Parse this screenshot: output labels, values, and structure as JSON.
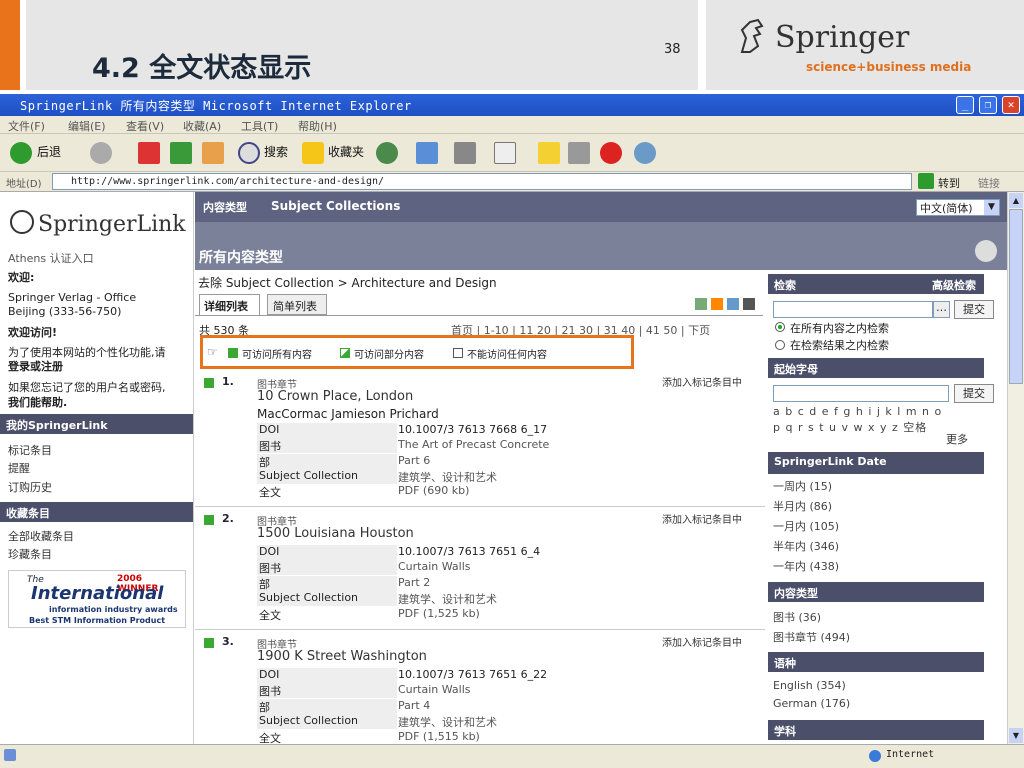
{
  "slide": {
    "title": "4.2 全文状态显示",
    "page": "38",
    "brand": "Springer",
    "tagline": "science+business media"
  },
  "window": {
    "title": "SpringerLink   所有内容类型   Microsoft Internet Explorer",
    "menu": [
      "文件(F)",
      "编辑(E)",
      "查看(V)",
      "收藏(A)",
      "工具(T)",
      "帮助(H)"
    ]
  },
  "toolbar": {
    "back": "后退",
    "search": "搜索",
    "favorites": "收藏夹"
  },
  "address": {
    "label": "地址(D)",
    "url": "http://www.springerlink.com/architecture-and-design/",
    "go": "转到",
    "links": "链接"
  },
  "left": {
    "logo": "SpringerLink",
    "athens": "Athens 认证入口",
    "welcome": "欢迎:",
    "org1": "Springer Verlag - Office",
    "org2": "Beijing (333-56-750)",
    "visit": "欢迎访问!",
    "p1": "为了使用本网站的个性化功能,请",
    "p1b": "登录或注册",
    "p2": "如果您忘记了您的用户名或密码,",
    "p2b": "我们能帮助.",
    "mylink": "我的SpringerLink",
    "my_items": [
      "标记条目",
      "提醒",
      "订购历史"
    ],
    "fav_head": "收藏条目",
    "fav_items": [
      "全部收藏条目",
      "珍藏条目"
    ],
    "award1": "The",
    "award2": "2006 WINNER",
    "award3": "International",
    "award4": "information industry awards",
    "award5": "Best STM Information Product"
  },
  "header": {
    "tab1": "内容类型",
    "tab2": "Subject Collections",
    "lang": "中文(简体)",
    "heading": "所有内容类型"
  },
  "center": {
    "crumb": "去除 Subject Collection > Architecture and Design",
    "view_detail": "详细列表",
    "view_brief": "简单列表",
    "total": "共 530 条",
    "pager": "首页 | 1-10 | 11 20 | 21 30 | 31 40 | 41 50 | 下页",
    "legend": [
      "可访问所有内容",
      "可访问部分内容",
      "不能访问任何内容"
    ]
  },
  "items": [
    {
      "num": "1.",
      "type": "图书章节",
      "title": "10 Crown Place, London",
      "author": "MacCormac Jamieson Prichard",
      "add": "添加入标记条目中",
      "rows": [
        [
          "DOI",
          "10.1007/3 7613 7668 6_17"
        ],
        [
          "图书",
          "The Art of Precast Concrete"
        ],
        [
          "部",
          "Part 6"
        ],
        [
          "Subject Collection",
          "建筑学、设计和艺术"
        ],
        [
          "全文",
          "PDF (690 kb)"
        ]
      ]
    },
    {
      "num": "2.",
      "type": "图书章节",
      "title": "1500 Louisiana Houston",
      "author": "",
      "add": "添加入标记条目中",
      "rows": [
        [
          "DOI",
          "10.1007/3 7613 7651 6_4"
        ],
        [
          "图书",
          "Curtain Walls"
        ],
        [
          "部",
          "Part 2"
        ],
        [
          "Subject Collection",
          "建筑学、设计和艺术"
        ],
        [
          "全文",
          "PDF (1,525 kb)"
        ]
      ]
    },
    {
      "num": "3.",
      "type": "图书章节",
      "title": "1900 K Street Washington",
      "author": "",
      "add": "添加入标记条目中",
      "rows": [
        [
          "DOI",
          "10.1007/3 7613 7651 6_22"
        ],
        [
          "图书",
          "Curtain Walls"
        ],
        [
          "部",
          "Part 4"
        ],
        [
          "Subject Collection",
          "建筑学、设计和艺术"
        ],
        [
          "全文",
          "PDF (1,515 kb)"
        ]
      ]
    }
  ],
  "right": {
    "search": "检索",
    "adv": "高级检索",
    "submit": "提交",
    "opt1": "在所有内容之内检索",
    "opt2": "在检索结果之内检索",
    "start": "起始字母",
    "letters1": "a b c d e f g h i j k l m n o",
    "letters2": "p q r s t u v w x y z 空格",
    "more": "更多",
    "date": "SpringerLink Date",
    "dates": [
      "一周内 (15)",
      "半月内 (86)",
      "一月内 (105)",
      "半年内 (346)",
      "一年内 (438)"
    ],
    "ctype": "内容类型",
    "ctypes": [
      "图书 (36)",
      "图书章节 (494)"
    ],
    "lang": "语种",
    "langs": [
      "English (354)",
      "German (176)"
    ],
    "subject": "学科"
  },
  "status": {
    "zone": "Internet"
  }
}
